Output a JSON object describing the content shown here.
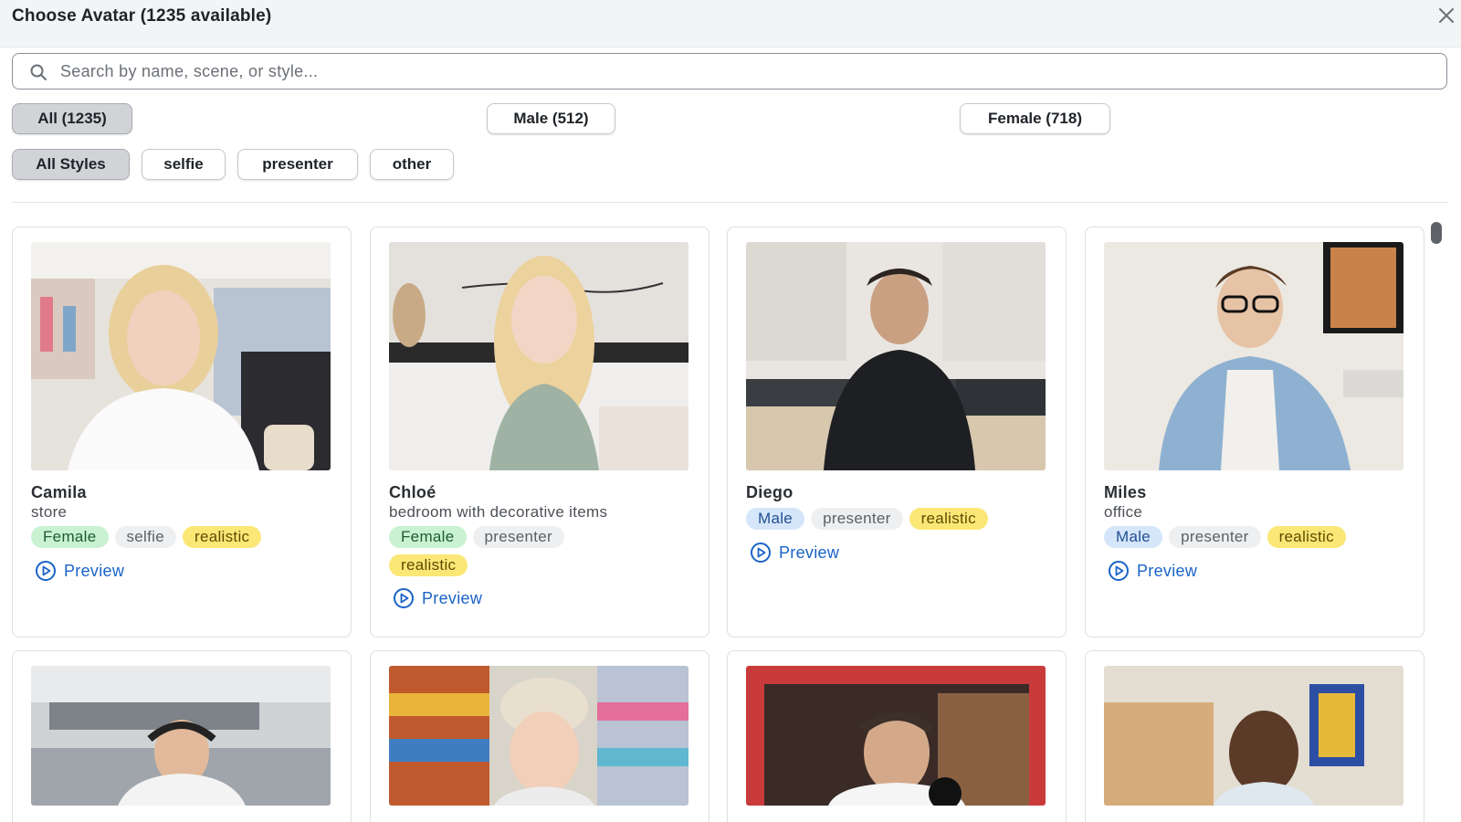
{
  "dialog": {
    "title": "Choose Avatar (1235 available)"
  },
  "search": {
    "placeholder": "Search by name, scene, or style..."
  },
  "gender_filters": [
    {
      "label": "All (1235)",
      "active": true
    },
    {
      "label": "Male (512)",
      "active": false
    },
    {
      "label": "Female (718)",
      "active": false
    }
  ],
  "style_filters": [
    {
      "label": "All Styles",
      "active": true
    },
    {
      "label": "selfie",
      "active": false
    },
    {
      "label": "presenter",
      "active": false
    },
    {
      "label": "other",
      "active": false
    }
  ],
  "avatars": [
    {
      "name": "Camila",
      "scene": "store",
      "tags": [
        "Female",
        "selfie",
        "realistic"
      ],
      "preview_label": "Preview"
    },
    {
      "name": "Chloé",
      "scene": "bedroom with decorative items",
      "tags": [
        "Female",
        "presenter",
        "realistic"
      ],
      "preview_label": "Preview"
    },
    {
      "name": "Diego",
      "scene": "",
      "tags": [
        "Male",
        "presenter",
        "realistic"
      ],
      "preview_label": "Preview"
    },
    {
      "name": "Miles",
      "scene": "office",
      "tags": [
        "Male",
        "presenter",
        "realistic"
      ],
      "preview_label": "Preview"
    }
  ],
  "colors": {
    "accent": "#1a63c7",
    "female_tag": "#c9f2d2",
    "male_tag": "#d5e6fb",
    "realistic_tag": "#fbe776",
    "style_tag": "#eeeff1"
  }
}
